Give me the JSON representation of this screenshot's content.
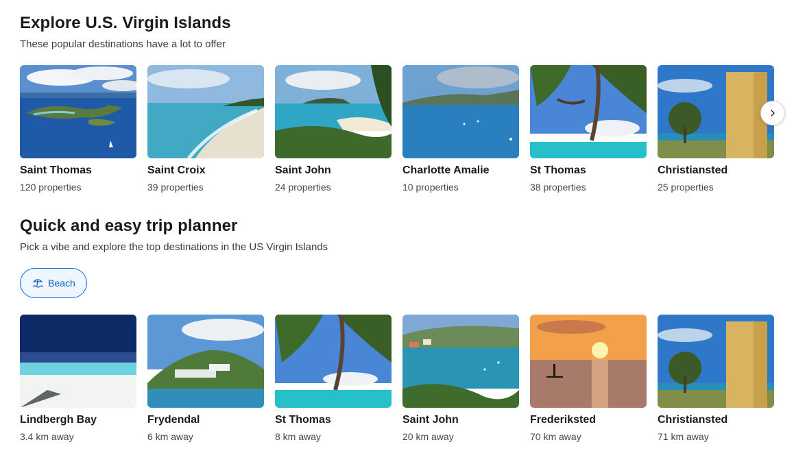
{
  "explore": {
    "title": "Explore U.S. Virgin Islands",
    "subtitle": "These popular destinations have a lot to offer",
    "cards": [
      {
        "name": "Saint Thomas",
        "detail": "120 properties"
      },
      {
        "name": "Saint Croix",
        "detail": "39 properties"
      },
      {
        "name": "Saint John",
        "detail": "24 properties"
      },
      {
        "name": "Charlotte Amalie",
        "detail": "10 properties"
      },
      {
        "name": "St Thomas",
        "detail": "38 properties"
      },
      {
        "name": "Christiansted",
        "detail": "25 properties"
      }
    ],
    "next_icon": "chevron-right-icon"
  },
  "planner": {
    "title": "Quick and easy trip planner",
    "subtitle": "Pick a vibe and explore the top destinations in the US Virgin Islands",
    "vibe": {
      "label": "Beach",
      "icon": "beach-icon"
    },
    "cards": [
      {
        "name": "Lindbergh Bay",
        "detail": "3.4 km away"
      },
      {
        "name": "Frydendal",
        "detail": "6 km away"
      },
      {
        "name": "St Thomas",
        "detail": "8 km away"
      },
      {
        "name": "Saint John",
        "detail": "20 km away"
      },
      {
        "name": "Frederiksted",
        "detail": "70 km away"
      },
      {
        "name": "Christiansted",
        "detail": "71 km away"
      }
    ]
  },
  "colors": {
    "accent": "#006ce4",
    "chip_bg": "#f0f6fe",
    "text": "#1a1a1a",
    "muted": "#474747"
  }
}
